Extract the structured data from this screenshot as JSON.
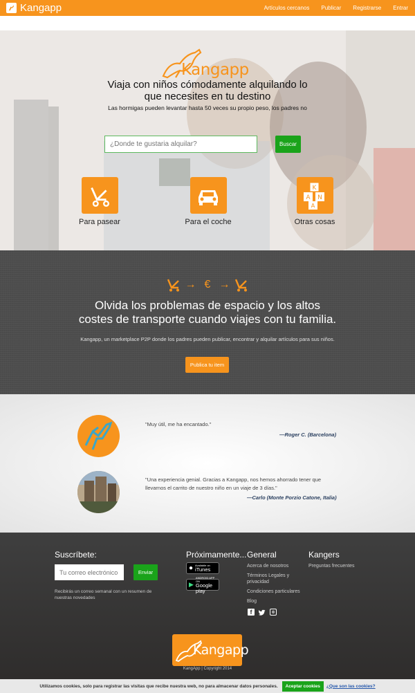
{
  "navbar": {
    "brand": "Kangapp",
    "links": [
      "Artículos cercanos",
      "Publicar",
      "Registrarse",
      "Entrar"
    ]
  },
  "hero": {
    "logo_text": "Kangapp",
    "title_line1": "Viaja con niños cómodamente alquilando lo",
    "title_line2": "que necesites en tu destino",
    "subtitle": "Las hormigas pueden levantar hasta 50 veces su propio peso, los padres no",
    "search_placeholder": "¿Donde te gustaria alquilar?",
    "search_button": "Buscar",
    "categories": [
      "Para pasear",
      "Para el coche",
      "Otras cosas"
    ]
  },
  "promo": {
    "flow_symbols": [
      "→",
      "€",
      "→"
    ],
    "title_line1": "Olvida los problemas de espacio y los altos",
    "title_line2": "costes de transporte cuando viajes con tu familia.",
    "description": "Kangapp, un marketplace P2P donde los padres pueden publicar, encontrar y alquilar artículos para sus niños.",
    "button": "Publica tu item"
  },
  "testimonials": [
    {
      "quote": "\"Muy útil, me ha encantado.\"",
      "author": "—Roger C. (Barcelona)"
    },
    {
      "quote_line1": "\"Una experiencia genial. Gracias a Kangapp, nos hemos ahorrado tener que",
      "quote_line2": "llevarnos el carrito de nuestro niño en un viaje de 3 días.\"",
      "author": "—Carlo (Monte Porzio Catone, Italia)"
    }
  ],
  "footer": {
    "subscribe_heading": "Suscríbete:",
    "email_placeholder": "Tu correo electrónico",
    "send_button": "Enviar",
    "subscribe_note": "Recibirás un correo semanal con un resumen de nuestras novedades",
    "soon_heading": "Próximamente...",
    "itunes_small": "Available on",
    "itunes_big": "iTunes",
    "gplay_small": "ANDROID APP ON",
    "gplay_big": "Google play",
    "general_heading": "General",
    "general_links": [
      "Acerca de nosotros",
      "Términos Legales y privacidad",
      "Condiciones particulares",
      "Blog"
    ],
    "kangers_heading": "Kangers",
    "kangers_links": [
      "Preguntas frecuentes"
    ],
    "social": [
      "f",
      "t",
      "◎"
    ],
    "logo_text": "Kangapp",
    "copyright": "KangApp | Copyright 2014"
  },
  "cookie": {
    "text": "Utilizamos cookies, solo para registrar las visitas que recibe nuestra web, no para almacenar datos personales.",
    "accept": "Aceptar cookies",
    "link": "¿Que son las cookies?"
  },
  "colors": {
    "brand_orange": "#f7941d",
    "green": "#1aa31a",
    "dark_bg": "#4d4d4d"
  }
}
